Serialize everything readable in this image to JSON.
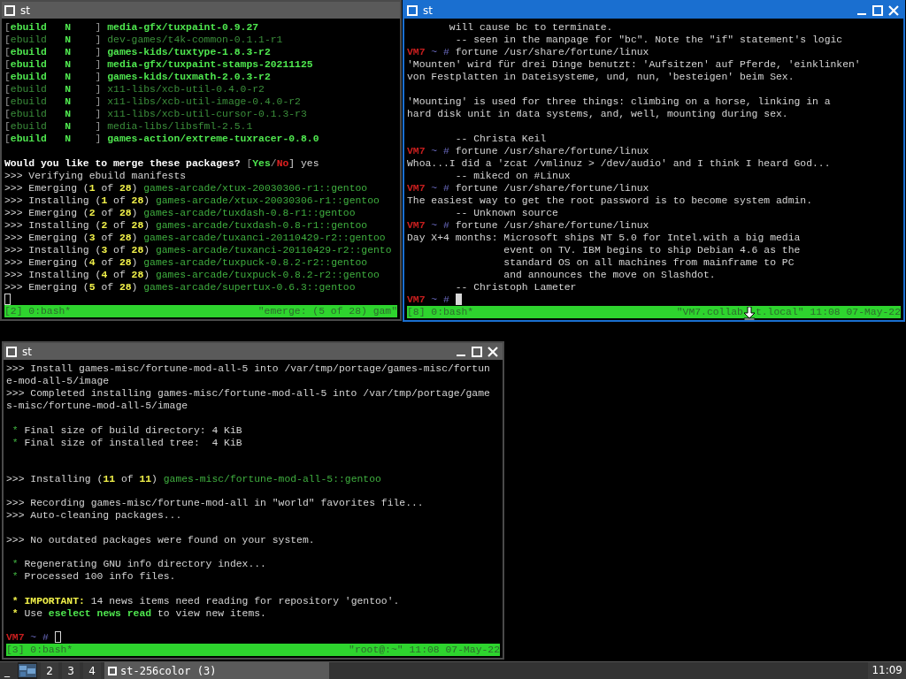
{
  "windows": [
    {
      "title": "st",
      "focused": false,
      "controls_shown": false,
      "status_bar": {
        "left": "[2] 0:bash*",
        "right": [
          "\"emerge: (5 of 28) gam\""
        ]
      },
      "lines": [
        {
          "kind": "text",
          "spans": [
            {
              "text": "[",
              "kind": "grey"
            },
            {
              "text": "ebuild",
              "kind": "green_bold"
            },
            {
              "text": "   N",
              "kind": "green_bold"
            },
            {
              "text": "    ] ",
              "kind": "grey"
            },
            {
              "text": "media-gfx/tuxpaint-0.9.27",
              "kind": "green_bold"
            }
          ]
        },
        {
          "kind": "text",
          "spans": [
            {
              "text": "[",
              "kind": "grey"
            },
            {
              "text": "ebuild",
              "kind": "dim_green"
            },
            {
              "text": "   N",
              "kind": "green_bold"
            },
            {
              "text": "    ] ",
              "kind": "grey"
            },
            {
              "text": "dev-games/t4k-common-0.1.1-r1",
              "kind": "dim_green"
            }
          ]
        },
        {
          "kind": "text",
          "spans": [
            {
              "text": "[",
              "kind": "grey"
            },
            {
              "text": "ebuild",
              "kind": "green_bold"
            },
            {
              "text": "   N",
              "kind": "green_bold"
            },
            {
              "text": "    ] ",
              "kind": "grey"
            },
            {
              "text": "games-kids/tuxtype-1.8.3-r2",
              "kind": "green_bold"
            }
          ]
        },
        {
          "kind": "text",
          "spans": [
            {
              "text": "[",
              "kind": "grey"
            },
            {
              "text": "ebuild",
              "kind": "green_bold"
            },
            {
              "text": "   N",
              "kind": "green_bold"
            },
            {
              "text": "    ] ",
              "kind": "grey"
            },
            {
              "text": "media-gfx/tuxpaint-stamps-20211125",
              "kind": "green_bold"
            }
          ]
        },
        {
          "kind": "text",
          "spans": [
            {
              "text": "[",
              "kind": "grey"
            },
            {
              "text": "ebuild",
              "kind": "green_bold"
            },
            {
              "text": "   N",
              "kind": "green_bold"
            },
            {
              "text": "    ] ",
              "kind": "grey"
            },
            {
              "text": "games-kids/tuxmath-2.0.3-r2",
              "kind": "green_bold"
            }
          ]
        },
        {
          "kind": "text",
          "spans": [
            {
              "text": "[",
              "kind": "grey"
            },
            {
              "text": "ebuild",
              "kind": "dim_green"
            },
            {
              "text": "   N",
              "kind": "green_bold"
            },
            {
              "text": "    ] ",
              "kind": "grey"
            },
            {
              "text": "x11-libs/xcb-util-0.4.0-r2",
              "kind": "dim_green"
            }
          ]
        },
        {
          "kind": "text",
          "spans": [
            {
              "text": "[",
              "kind": "grey"
            },
            {
              "text": "ebuild",
              "kind": "dim_green"
            },
            {
              "text": "   N",
              "kind": "green_bold"
            },
            {
              "text": "    ] ",
              "kind": "grey"
            },
            {
              "text": "x11-libs/xcb-util-image-0.4.0-r2",
              "kind": "dim_green"
            }
          ]
        },
        {
          "kind": "text",
          "spans": [
            {
              "text": "[",
              "kind": "grey"
            },
            {
              "text": "ebuild",
              "kind": "dim_green"
            },
            {
              "text": "   N",
              "kind": "green_bold"
            },
            {
              "text": "    ] ",
              "kind": "grey"
            },
            {
              "text": "x11-libs/xcb-util-cursor-0.1.3-r3",
              "kind": "dim_green"
            }
          ]
        },
        {
          "kind": "text",
          "spans": [
            {
              "text": "[",
              "kind": "grey"
            },
            {
              "text": "ebuild",
              "kind": "dim_green"
            },
            {
              "text": "   N",
              "kind": "green_bold"
            },
            {
              "text": "    ] ",
              "kind": "grey"
            },
            {
              "text": "media-libs/libsfml-2.5.1",
              "kind": "dim_green"
            }
          ]
        },
        {
          "kind": "text",
          "spans": [
            {
              "text": "[",
              "kind": "grey"
            },
            {
              "text": "ebuild",
              "kind": "green_bold"
            },
            {
              "text": "   N",
              "kind": "green_bold"
            },
            {
              "text": "    ] ",
              "kind": "grey"
            },
            {
              "text": "games-action/extreme-tuxracer-0.8.0",
              "kind": "green_bold"
            }
          ]
        },
        {
          "kind": "blank"
        },
        {
          "kind": "text",
          "spans": [
            {
              "text": "Would you like to merge these packages? ",
              "kind": "white_bold"
            },
            {
              "text": "[",
              "kind": "grey"
            },
            {
              "text": "Yes",
              "kind": "green_bold"
            },
            {
              "text": "/",
              "kind": "grey"
            },
            {
              "text": "No",
              "kind": "red_bold"
            },
            {
              "text": "] yes",
              "kind": "plain"
            }
          ]
        },
        {
          "kind": "text",
          "spans": [
            {
              "text": ">>> Verifying ebuild manifests",
              "kind": "plain"
            }
          ]
        },
        {
          "kind": "text",
          "spans": [
            {
              "text": ">>> Emerging (",
              "kind": "plain"
            },
            {
              "text": "1",
              "kind": "yellow_bold"
            },
            {
              "text": " of ",
              "kind": "plain"
            },
            {
              "text": "28",
              "kind": "yellow_bold"
            },
            {
              "text": ") ",
              "kind": "plain"
            },
            {
              "text": "games-arcade/xtux-20030306-r1::gentoo",
              "kind": "green"
            }
          ]
        },
        {
          "kind": "text",
          "spans": [
            {
              "text": ">>> Installing (",
              "kind": "plain"
            },
            {
              "text": "1",
              "kind": "yellow_bold"
            },
            {
              "text": " of ",
              "kind": "plain"
            },
            {
              "text": "28",
              "kind": "yellow_bold"
            },
            {
              "text": ") ",
              "kind": "plain"
            },
            {
              "text": "games-arcade/xtux-20030306-r1::gentoo",
              "kind": "green"
            }
          ]
        },
        {
          "kind": "text",
          "spans": [
            {
              "text": ">>> Emerging (",
              "kind": "plain"
            },
            {
              "text": "2",
              "kind": "yellow_bold"
            },
            {
              "text": " of ",
              "kind": "plain"
            },
            {
              "text": "28",
              "kind": "yellow_bold"
            },
            {
              "text": ") ",
              "kind": "plain"
            },
            {
              "text": "games-arcade/tuxdash-0.8-r1::gentoo",
              "kind": "green"
            }
          ]
        },
        {
          "kind": "text",
          "spans": [
            {
              "text": ">>> Installing (",
              "kind": "plain"
            },
            {
              "text": "2",
              "kind": "yellow_bold"
            },
            {
              "text": " of ",
              "kind": "plain"
            },
            {
              "text": "28",
              "kind": "yellow_bold"
            },
            {
              "text": ") ",
              "kind": "plain"
            },
            {
              "text": "games-arcade/tuxdash-0.8-r1::gentoo",
              "kind": "green"
            }
          ]
        },
        {
          "kind": "text",
          "spans": [
            {
              "text": ">>> Emerging (",
              "kind": "plain"
            },
            {
              "text": "3",
              "kind": "yellow_bold"
            },
            {
              "text": " of ",
              "kind": "plain"
            },
            {
              "text": "28",
              "kind": "yellow_bold"
            },
            {
              "text": ") ",
              "kind": "plain"
            },
            {
              "text": "games-arcade/tuxanci-20110429-r2::gentoo",
              "kind": "green"
            }
          ]
        },
        {
          "kind": "text",
          "spans": [
            {
              "text": ">>> Installing (",
              "kind": "plain"
            },
            {
              "text": "3",
              "kind": "yellow_bold"
            },
            {
              "text": " of ",
              "kind": "plain"
            },
            {
              "text": "28",
              "kind": "yellow_bold"
            },
            {
              "text": ") ",
              "kind": "plain"
            },
            {
              "text": "games-arcade/tuxanci-20110429-r2::gento",
              "kind": "green"
            }
          ]
        },
        {
          "kind": "text",
          "spans": [
            {
              "text": ">>> Emerging (",
              "kind": "plain"
            },
            {
              "text": "4",
              "kind": "yellow_bold"
            },
            {
              "text": " of ",
              "kind": "plain"
            },
            {
              "text": "28",
              "kind": "yellow_bold"
            },
            {
              "text": ") ",
              "kind": "plain"
            },
            {
              "text": "games-arcade/tuxpuck-0.8.2-r2::gentoo",
              "kind": "green"
            }
          ]
        },
        {
          "kind": "text",
          "spans": [
            {
              "text": ">>> Installing (",
              "kind": "plain"
            },
            {
              "text": "4",
              "kind": "yellow_bold"
            },
            {
              "text": " of ",
              "kind": "plain"
            },
            {
              "text": "28",
              "kind": "yellow_bold"
            },
            {
              "text": ") ",
              "kind": "plain"
            },
            {
              "text": "games-arcade/tuxpuck-0.8.2-r2::gentoo",
              "kind": "green"
            }
          ]
        },
        {
          "kind": "text",
          "spans": [
            {
              "text": ">>> Emerging (",
              "kind": "plain"
            },
            {
              "text": "5",
              "kind": "yellow_bold"
            },
            {
              "text": " of ",
              "kind": "plain"
            },
            {
              "text": "28",
              "kind": "yellow_bold"
            },
            {
              "text": ") ",
              "kind": "plain"
            },
            {
              "text": "games-arcade/supertux-0.6.3::gentoo",
              "kind": "green"
            }
          ]
        },
        {
          "kind": "cursor"
        }
      ]
    },
    {
      "title": "st",
      "focused": true,
      "controls_shown": true,
      "status_bar": {
        "left": "[8] 0:bash*",
        "right": [
          "\"VM7.collab",
          "t.local\" 11:08 07-May-22"
        ]
      },
      "lines": [
        {
          "kind": "text",
          "spans": [
            {
              "text": "       will cause bc to terminate.",
              "kind": "plain"
            }
          ]
        },
        {
          "kind": "text",
          "spans": [
            {
              "text": "        -- seen in the manpage for \"bc\". Note the \"if\" statement's logic",
              "kind": "plain"
            }
          ]
        },
        {
          "kind": "text",
          "spans": [
            {
              "text": "VM7",
              "kind": "prompt_host"
            },
            {
              "text": " ~ #",
              "kind": "prompt_path"
            },
            {
              "text": " fortune /usr/share/fortune/linux",
              "kind": "plain"
            }
          ]
        },
        {
          "kind": "text",
          "spans": [
            {
              "text": "'Mounten' wird für drei Dinge benutzt: 'Aufsitzen' auf Pferde, 'einklinken'",
              "kind": "plain"
            }
          ]
        },
        {
          "kind": "text",
          "spans": [
            {
              "text": "von Festplatten in Dateisysteme, und, nun, 'besteigen' beim Sex.",
              "kind": "plain"
            }
          ]
        },
        {
          "kind": "blank"
        },
        {
          "kind": "text",
          "spans": [
            {
              "text": "'Mounting' is used for three things: climbing on a horse, linking in a",
              "kind": "plain"
            }
          ]
        },
        {
          "kind": "text",
          "spans": [
            {
              "text": "hard disk unit in data systems, and, well, mounting during sex.",
              "kind": "plain"
            }
          ]
        },
        {
          "kind": "blank"
        },
        {
          "kind": "text",
          "spans": [
            {
              "text": "        -- Christa Keil",
              "kind": "plain"
            }
          ]
        },
        {
          "kind": "text",
          "spans": [
            {
              "text": "VM7",
              "kind": "prompt_host"
            },
            {
              "text": " ~ #",
              "kind": "prompt_path"
            },
            {
              "text": " fortune /usr/share/fortune/linux",
              "kind": "plain"
            }
          ]
        },
        {
          "kind": "text",
          "spans": [
            {
              "text": "Whoa...I did a 'zcat /vmlinuz > /dev/audio' and I think I heard God...",
              "kind": "plain"
            }
          ]
        },
        {
          "kind": "text",
          "spans": [
            {
              "text": "        -- mikecd on #Linux",
              "kind": "plain"
            }
          ]
        },
        {
          "kind": "text",
          "spans": [
            {
              "text": "VM7",
              "kind": "prompt_host"
            },
            {
              "text": " ~ #",
              "kind": "prompt_path"
            },
            {
              "text": " fortune /usr/share/fortune/linux",
              "kind": "plain"
            }
          ]
        },
        {
          "kind": "text",
          "spans": [
            {
              "text": "The easiest way to get the root password is to become system admin.",
              "kind": "plain"
            }
          ]
        },
        {
          "kind": "text",
          "spans": [
            {
              "text": "        -- Unknown source",
              "kind": "plain"
            }
          ]
        },
        {
          "kind": "text",
          "spans": [
            {
              "text": "VM7",
              "kind": "prompt_host"
            },
            {
              "text": " ~ #",
              "kind": "prompt_path"
            },
            {
              "text": " fortune /usr/share/fortune/linux",
              "kind": "plain"
            }
          ]
        },
        {
          "kind": "text",
          "spans": [
            {
              "text": "Day X+4 months: Microsoft ships NT 5.0 for Intel.with a big media",
              "kind": "plain"
            }
          ]
        },
        {
          "kind": "text",
          "spans": [
            {
              "text": "                event on TV. IBM begins to ship Debian 4.6 as the",
              "kind": "plain"
            }
          ]
        },
        {
          "kind": "text",
          "spans": [
            {
              "text": "                standard OS on all machines from mainframe to PC",
              "kind": "plain"
            }
          ]
        },
        {
          "kind": "text",
          "spans": [
            {
              "text": "                and announces the move on Slashdot.",
              "kind": "plain"
            }
          ]
        },
        {
          "kind": "text",
          "spans": [
            {
              "text": "        -- Christoph Lameter",
              "kind": "plain"
            }
          ]
        },
        {
          "kind": "prompt_cursor",
          "spans": [
            {
              "text": "VM7",
              "kind": "prompt_host"
            },
            {
              "text": " ~ #",
              "kind": "prompt_path"
            }
          ]
        }
      ]
    },
    {
      "title": "st",
      "focused": false,
      "controls_shown": true,
      "status_bar": {
        "left": "[3] 0:bash*",
        "right": [
          "\"root@:~\" 11:08 07-May-22"
        ]
      },
      "lines": [
        {
          "kind": "text",
          "spans": [
            {
              "text": ">>> Install games-misc/fortune-mod-all-5 into /var/tmp/portage/games-misc/fortun",
              "kind": "plain"
            }
          ]
        },
        {
          "kind": "text",
          "spans": [
            {
              "text": "e-mod-all-5/image",
              "kind": "plain"
            }
          ]
        },
        {
          "kind": "text",
          "spans": [
            {
              "text": ">>> Completed installing games-misc/fortune-mod-all-5 into /var/tmp/portage/game",
              "kind": "plain"
            }
          ]
        },
        {
          "kind": "text",
          "spans": [
            {
              "text": "s-misc/fortune-mod-all-5/image",
              "kind": "plain"
            }
          ]
        },
        {
          "kind": "blank"
        },
        {
          "kind": "text",
          "spans": [
            {
              "text": " * ",
              "kind": "green"
            },
            {
              "text": "Final size of build directory: 4 KiB",
              "kind": "plain"
            }
          ]
        },
        {
          "kind": "text",
          "spans": [
            {
              "text": " * ",
              "kind": "green"
            },
            {
              "text": "Final size of installed tree:  4 KiB",
              "kind": "plain"
            }
          ]
        },
        {
          "kind": "blank"
        },
        {
          "kind": "blank"
        },
        {
          "kind": "text",
          "spans": [
            {
              "text": ">>> Installing (",
              "kind": "plain"
            },
            {
              "text": "11",
              "kind": "yellow_bold"
            },
            {
              "text": " of ",
              "kind": "plain"
            },
            {
              "text": "11",
              "kind": "yellow_bold"
            },
            {
              "text": ") ",
              "kind": "plain"
            },
            {
              "text": "games-misc/fortune-mod-all-5::gentoo",
              "kind": "green"
            }
          ]
        },
        {
          "kind": "blank"
        },
        {
          "kind": "text",
          "spans": [
            {
              "text": ">>> Recording games-misc/fortune-mod-all in \"world\" favorites file...",
              "kind": "plain"
            }
          ]
        },
        {
          "kind": "text",
          "spans": [
            {
              "text": ">>> Auto-cleaning packages...",
              "kind": "plain"
            }
          ]
        },
        {
          "kind": "blank"
        },
        {
          "kind": "text",
          "spans": [
            {
              "text": ">>> No outdated packages were found on your system.",
              "kind": "plain"
            }
          ]
        },
        {
          "kind": "blank"
        },
        {
          "kind": "text",
          "spans": [
            {
              "text": " * ",
              "kind": "green"
            },
            {
              "text": "Regenerating GNU info directory index...",
              "kind": "plain"
            }
          ]
        },
        {
          "kind": "text",
          "spans": [
            {
              "text": " * ",
              "kind": "green"
            },
            {
              "text": "Processed 100 info files.",
              "kind": "plain"
            }
          ]
        },
        {
          "kind": "blank"
        },
        {
          "kind": "text",
          "spans": [
            {
              "text": " * ",
              "kind": "yellow_bold"
            },
            {
              "text": "IMPORTANT:",
              "kind": "yellow_bold"
            },
            {
              "text": " 14 news items need reading for repository 'gentoo'.",
              "kind": "plain"
            }
          ]
        },
        {
          "kind": "text",
          "spans": [
            {
              "text": " * ",
              "kind": "yellow_bold"
            },
            {
              "text": "Use ",
              "kind": "plain"
            },
            {
              "text": "eselect news read",
              "kind": "green_bold"
            },
            {
              "text": " to view new items.",
              "kind": "plain"
            }
          ]
        },
        {
          "kind": "blank"
        },
        {
          "kind": "prompt_cursor",
          "spans": [
            {
              "text": "VM7",
              "kind": "prompt_host"
            },
            {
              "text": " ~ #",
              "kind": "prompt_path"
            }
          ]
        }
      ]
    }
  ],
  "taskbar": {
    "menu_glyph": "_",
    "workspaces": [
      {
        "kind": "pager",
        "selected": true
      },
      {
        "kind": "number",
        "label": "2",
        "selected": false
      },
      {
        "kind": "number",
        "label": "3",
        "selected": false
      },
      {
        "kind": "number",
        "label": "4",
        "selected": false
      }
    ],
    "tasks": [
      {
        "label": "st-256color (3)",
        "selected": true
      }
    ],
    "clock": "11:09"
  }
}
